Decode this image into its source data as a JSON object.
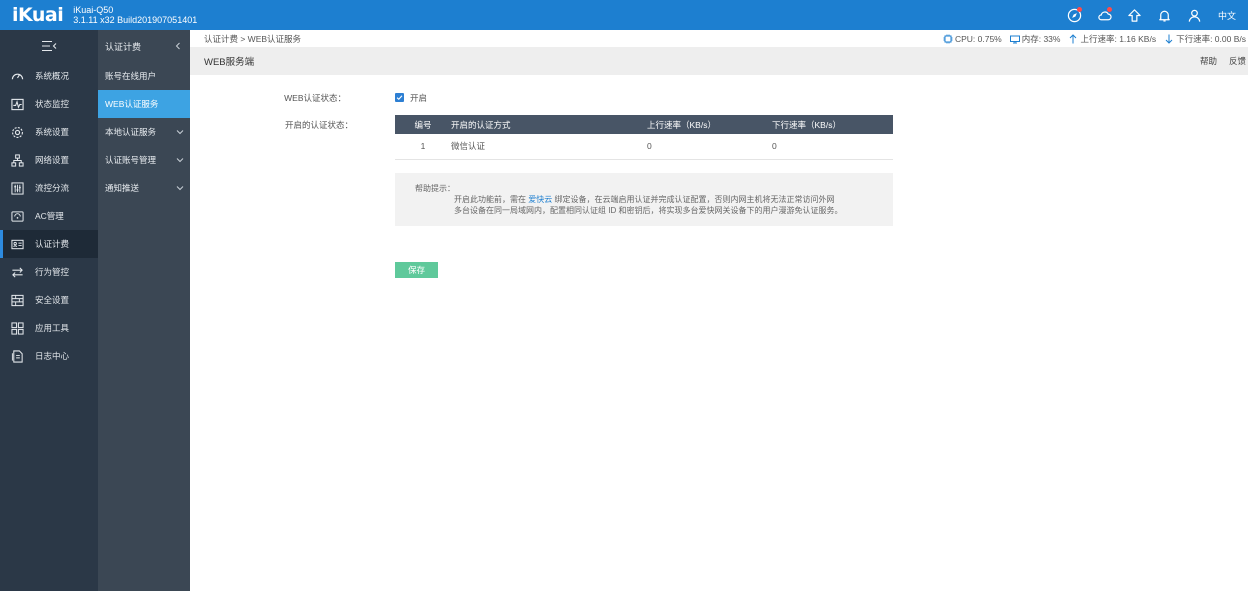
{
  "topbar": {
    "logo": "iKuai",
    "model": "iKuai-Q50",
    "version": "3.1.11 x32 Build201907051401",
    "language": "中文"
  },
  "leftnav": {
    "items": [
      {
        "label": "系统概况",
        "icon": "dashboard-icon"
      },
      {
        "label": "状态监控",
        "icon": "monitor-icon"
      },
      {
        "label": "系统设置",
        "icon": "gear-icon"
      },
      {
        "label": "网络设置",
        "icon": "network-icon"
      },
      {
        "label": "流控分流",
        "icon": "sliders-icon"
      },
      {
        "label": "AC管理",
        "icon": "ac-icon"
      },
      {
        "label": "认证计费",
        "icon": "id-card-icon",
        "active": true
      },
      {
        "label": "行为管控",
        "icon": "arrows-icon"
      },
      {
        "label": "安全设置",
        "icon": "firewall-icon"
      },
      {
        "label": "应用工具",
        "icon": "apps-icon"
      },
      {
        "label": "日志中心",
        "icon": "log-icon"
      }
    ]
  },
  "subnav": {
    "title": "认证计费",
    "items": [
      {
        "label": "账号在线用户",
        "has_arrow": false
      },
      {
        "label": "WEB认证服务",
        "has_arrow": false,
        "active": true
      },
      {
        "label": "本地认证服务",
        "has_arrow": true
      },
      {
        "label": "认证账号管理",
        "has_arrow": true
      },
      {
        "label": "通知推送",
        "has_arrow": true
      }
    ]
  },
  "breadcrumb": "认证计费 > WEB认证服务",
  "stats": {
    "cpu": "CPU: 0.75%",
    "memory": "内存: 33%",
    "upload": "上行速率: 1.16 KB/s",
    "download": "下行速率: 0.00 B/s"
  },
  "page": {
    "title": "WEB服务端",
    "help_link": "帮助",
    "feedback_link": "反馈"
  },
  "form": {
    "status_label": "WEB认证状态：",
    "status_checked_label": "开启",
    "methods_label": "开启的认证状态：",
    "table": {
      "headers": [
        "编号",
        "开启的认证方式",
        "上行速率（KB/s）",
        "下行速率（KB/s）"
      ],
      "rows": [
        [
          "1",
          "微信认证",
          "0",
          "0"
        ]
      ]
    },
    "help": {
      "title": "帮助提示：",
      "line1_a": "开启此功能前，需在",
      "line1_link": "爱快云",
      "line1_b": "绑定设备，在云端启用认证并完成认证配置，否则内网主机将无法正常访问外网",
      "line2": "多台设备在同一局域网内，配置相同认证组 ID 和密钥后，将实现多台爱快网关设备下的用户漫游免认证服务。"
    },
    "save_button": "保存"
  },
  "colors": {
    "topbar": "#1d7fd0",
    "leftnav": "#2b3847",
    "subnav": "#3b4754",
    "subnav_active": "#3da3e3",
    "table_header": "#485566",
    "save_button": "#5fc99b"
  }
}
